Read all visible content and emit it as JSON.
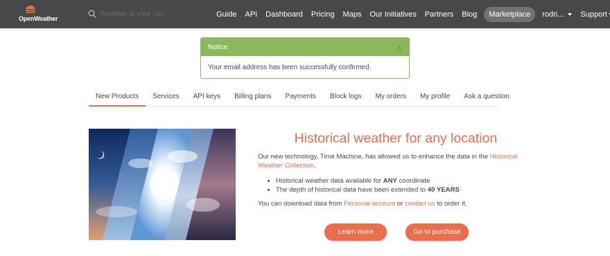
{
  "header": {
    "brand": "OpenWeather",
    "search": {
      "placeholder": "Weather in your city"
    },
    "nav": [
      {
        "label": "Guide"
      },
      {
        "label": "API"
      },
      {
        "label": "Dashboard"
      },
      {
        "label": "Pricing"
      },
      {
        "label": "Maps"
      },
      {
        "label": "Our Initiatives"
      },
      {
        "label": "Partners"
      },
      {
        "label": "Blog"
      },
      {
        "label": "Marketplace"
      }
    ],
    "user": "rodri...",
    "support": "Support"
  },
  "notice": {
    "title": "Notice",
    "close": "X",
    "message": "Your email address has been successfully confirmed."
  },
  "tabs": [
    {
      "label": "New Products"
    },
    {
      "label": "Services"
    },
    {
      "label": "API keys"
    },
    {
      "label": "Billing plans"
    },
    {
      "label": "Payments"
    },
    {
      "label": "Block logs"
    },
    {
      "label": "My orders"
    },
    {
      "label": "My profile"
    },
    {
      "label": "Ask a question"
    }
  ],
  "hero": {
    "title": "Historical weather for any location",
    "intro": "Our new technology, Time Machine, has allowed us to enhance the data in the ",
    "intro_link": "Historical Weather Collection",
    "intro_end": ".",
    "bullets": [
      {
        "pre": "Historical weather data available for ",
        "bold": "ANY",
        "post": " coordinate"
      },
      {
        "pre": "The depth of historical data have been extended to ",
        "bold": "40 YEARS",
        "post": ""
      }
    ],
    "download_pre": "You can download data from ",
    "download_link1": "Personal account",
    "download_mid": " or ",
    "download_link2": "contact us",
    "download_post": " to order it.",
    "learn_more": "Learn more",
    "purchase": "Go to purchase"
  },
  "colors": {
    "accent": "#eb6e4b",
    "nav_bg": "#48484a",
    "notice_green": "#8bb85d"
  }
}
